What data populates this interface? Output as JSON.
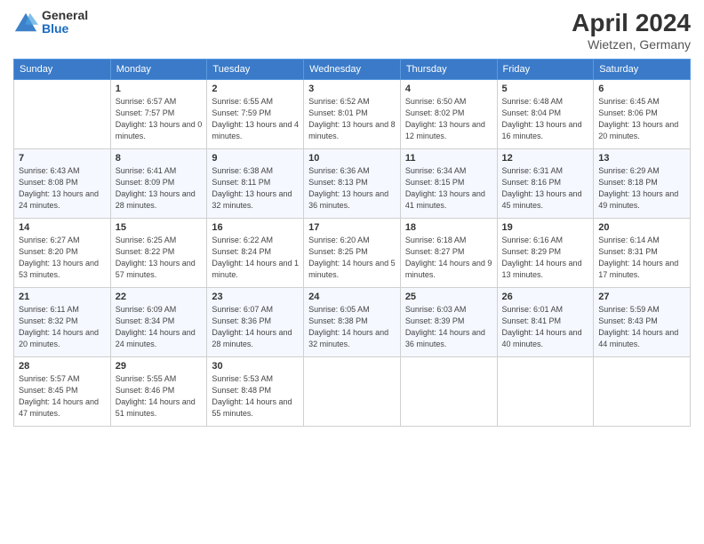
{
  "logo": {
    "general": "General",
    "blue": "Blue"
  },
  "header": {
    "month_year": "April 2024",
    "location": "Wietzen, Germany"
  },
  "days_of_week": [
    "Sunday",
    "Monday",
    "Tuesday",
    "Wednesday",
    "Thursday",
    "Friday",
    "Saturday"
  ],
  "weeks": [
    [
      {
        "day": "",
        "sunrise": "",
        "sunset": "",
        "daylight": ""
      },
      {
        "day": "1",
        "sunrise": "Sunrise: 6:57 AM",
        "sunset": "Sunset: 7:57 PM",
        "daylight": "Daylight: 13 hours and 0 minutes."
      },
      {
        "day": "2",
        "sunrise": "Sunrise: 6:55 AM",
        "sunset": "Sunset: 7:59 PM",
        "daylight": "Daylight: 13 hours and 4 minutes."
      },
      {
        "day": "3",
        "sunrise": "Sunrise: 6:52 AM",
        "sunset": "Sunset: 8:01 PM",
        "daylight": "Daylight: 13 hours and 8 minutes."
      },
      {
        "day": "4",
        "sunrise": "Sunrise: 6:50 AM",
        "sunset": "Sunset: 8:02 PM",
        "daylight": "Daylight: 13 hours and 12 minutes."
      },
      {
        "day": "5",
        "sunrise": "Sunrise: 6:48 AM",
        "sunset": "Sunset: 8:04 PM",
        "daylight": "Daylight: 13 hours and 16 minutes."
      },
      {
        "day": "6",
        "sunrise": "Sunrise: 6:45 AM",
        "sunset": "Sunset: 8:06 PM",
        "daylight": "Daylight: 13 hours and 20 minutes."
      }
    ],
    [
      {
        "day": "7",
        "sunrise": "Sunrise: 6:43 AM",
        "sunset": "Sunset: 8:08 PM",
        "daylight": "Daylight: 13 hours and 24 minutes."
      },
      {
        "day": "8",
        "sunrise": "Sunrise: 6:41 AM",
        "sunset": "Sunset: 8:09 PM",
        "daylight": "Daylight: 13 hours and 28 minutes."
      },
      {
        "day": "9",
        "sunrise": "Sunrise: 6:38 AM",
        "sunset": "Sunset: 8:11 PM",
        "daylight": "Daylight: 13 hours and 32 minutes."
      },
      {
        "day": "10",
        "sunrise": "Sunrise: 6:36 AM",
        "sunset": "Sunset: 8:13 PM",
        "daylight": "Daylight: 13 hours and 36 minutes."
      },
      {
        "day": "11",
        "sunrise": "Sunrise: 6:34 AM",
        "sunset": "Sunset: 8:15 PM",
        "daylight": "Daylight: 13 hours and 41 minutes."
      },
      {
        "day": "12",
        "sunrise": "Sunrise: 6:31 AM",
        "sunset": "Sunset: 8:16 PM",
        "daylight": "Daylight: 13 hours and 45 minutes."
      },
      {
        "day": "13",
        "sunrise": "Sunrise: 6:29 AM",
        "sunset": "Sunset: 8:18 PM",
        "daylight": "Daylight: 13 hours and 49 minutes."
      }
    ],
    [
      {
        "day": "14",
        "sunrise": "Sunrise: 6:27 AM",
        "sunset": "Sunset: 8:20 PM",
        "daylight": "Daylight: 13 hours and 53 minutes."
      },
      {
        "day": "15",
        "sunrise": "Sunrise: 6:25 AM",
        "sunset": "Sunset: 8:22 PM",
        "daylight": "Daylight: 13 hours and 57 minutes."
      },
      {
        "day": "16",
        "sunrise": "Sunrise: 6:22 AM",
        "sunset": "Sunset: 8:24 PM",
        "daylight": "Daylight: 14 hours and 1 minute."
      },
      {
        "day": "17",
        "sunrise": "Sunrise: 6:20 AM",
        "sunset": "Sunset: 8:25 PM",
        "daylight": "Daylight: 14 hours and 5 minutes."
      },
      {
        "day": "18",
        "sunrise": "Sunrise: 6:18 AM",
        "sunset": "Sunset: 8:27 PM",
        "daylight": "Daylight: 14 hours and 9 minutes."
      },
      {
        "day": "19",
        "sunrise": "Sunrise: 6:16 AM",
        "sunset": "Sunset: 8:29 PM",
        "daylight": "Daylight: 14 hours and 13 minutes."
      },
      {
        "day": "20",
        "sunrise": "Sunrise: 6:14 AM",
        "sunset": "Sunset: 8:31 PM",
        "daylight": "Daylight: 14 hours and 17 minutes."
      }
    ],
    [
      {
        "day": "21",
        "sunrise": "Sunrise: 6:11 AM",
        "sunset": "Sunset: 8:32 PM",
        "daylight": "Daylight: 14 hours and 20 minutes."
      },
      {
        "day": "22",
        "sunrise": "Sunrise: 6:09 AM",
        "sunset": "Sunset: 8:34 PM",
        "daylight": "Daylight: 14 hours and 24 minutes."
      },
      {
        "day": "23",
        "sunrise": "Sunrise: 6:07 AM",
        "sunset": "Sunset: 8:36 PM",
        "daylight": "Daylight: 14 hours and 28 minutes."
      },
      {
        "day": "24",
        "sunrise": "Sunrise: 6:05 AM",
        "sunset": "Sunset: 8:38 PM",
        "daylight": "Daylight: 14 hours and 32 minutes."
      },
      {
        "day": "25",
        "sunrise": "Sunrise: 6:03 AM",
        "sunset": "Sunset: 8:39 PM",
        "daylight": "Daylight: 14 hours and 36 minutes."
      },
      {
        "day": "26",
        "sunrise": "Sunrise: 6:01 AM",
        "sunset": "Sunset: 8:41 PM",
        "daylight": "Daylight: 14 hours and 40 minutes."
      },
      {
        "day": "27",
        "sunrise": "Sunrise: 5:59 AM",
        "sunset": "Sunset: 8:43 PM",
        "daylight": "Daylight: 14 hours and 44 minutes."
      }
    ],
    [
      {
        "day": "28",
        "sunrise": "Sunrise: 5:57 AM",
        "sunset": "Sunset: 8:45 PM",
        "daylight": "Daylight: 14 hours and 47 minutes."
      },
      {
        "day": "29",
        "sunrise": "Sunrise: 5:55 AM",
        "sunset": "Sunset: 8:46 PM",
        "daylight": "Daylight: 14 hours and 51 minutes."
      },
      {
        "day": "30",
        "sunrise": "Sunrise: 5:53 AM",
        "sunset": "Sunset: 8:48 PM",
        "daylight": "Daylight: 14 hours and 55 minutes."
      },
      {
        "day": "",
        "sunrise": "",
        "sunset": "",
        "daylight": ""
      },
      {
        "day": "",
        "sunrise": "",
        "sunset": "",
        "daylight": ""
      },
      {
        "day": "",
        "sunrise": "",
        "sunset": "",
        "daylight": ""
      },
      {
        "day": "",
        "sunrise": "",
        "sunset": "",
        "daylight": ""
      }
    ]
  ]
}
